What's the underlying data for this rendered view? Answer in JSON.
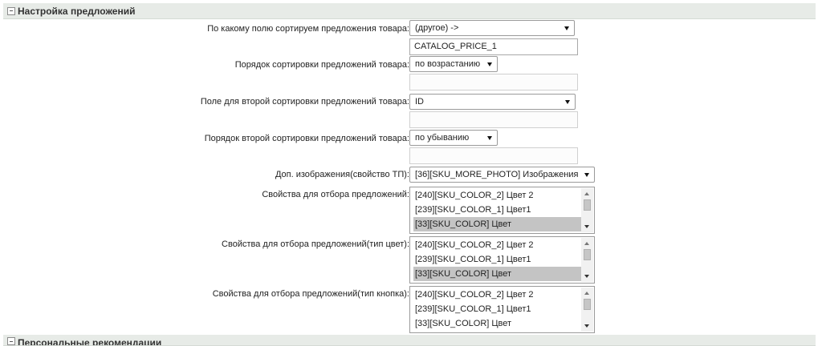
{
  "sections": {
    "offers_settings": "Настройка предложений",
    "personal_recommendations": "Персональные рекомендации"
  },
  "fields": {
    "sort_field_label": "По какому полю сортируем предложения товара:",
    "sort_field_value": "(другое) ->",
    "sort_field_custom": "CATALOG_PRICE_1",
    "sort_order_label": "Порядок сортировки предложений товара:",
    "sort_order_value": "по возрастанию",
    "sort2_field_label": "Поле для второй сортировки предложений товара:",
    "sort2_field_value": "ID",
    "sort2_order_label": "Порядок второй сортировки предложений товара:",
    "sort2_order_value": "по убыванию",
    "more_photo_label": "Доп. изображения(свойство ТП):",
    "more_photo_value": "[36][SKU_MORE_PHOTO] Изображения"
  },
  "lists": {
    "tree_props_label": "Свойства для отбора предложений:",
    "color_props_label": "Свойства для отбора предложений(тип цвет):",
    "button_props_label": "Свойства для отбора предложений(тип кнопка):",
    "options": [
      "[240][SKU_COLOR_2] Цвет 2",
      "[239][SKU_COLOR_1] Цвет1",
      "[33][SKU_COLOR] Цвет"
    ]
  }
}
